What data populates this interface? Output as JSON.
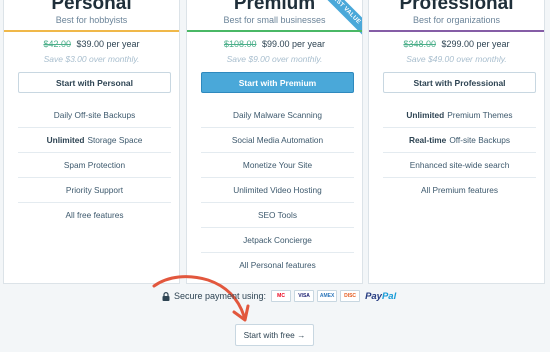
{
  "plans": {
    "personal": {
      "name": "Personal",
      "subtitle": "Best for hobbyists",
      "old_price": "$42.00",
      "price": "$39.00 per year",
      "savings": "Save $3.00 over monthly.",
      "button": "Start with Personal",
      "features": [
        {
          "bold": "",
          "text": "Daily Off-site Backups"
        },
        {
          "bold": "Unlimited",
          "text": "Storage Space"
        },
        {
          "bold": "",
          "text": "Spam Protection"
        },
        {
          "bold": "",
          "text": "Priority Support"
        },
        {
          "bold": "",
          "text": "All free features"
        }
      ]
    },
    "premium": {
      "name": "Premium",
      "subtitle": "Best for small businesses",
      "ribbon": "BEST VALUE",
      "old_price": "$108.00",
      "price": "$99.00 per year",
      "savings": "Save $9.00 over monthly.",
      "button": "Start with Premium",
      "features": [
        {
          "bold": "",
          "text": "Daily Malware Scanning"
        },
        {
          "bold": "",
          "text": "Social Media Automation"
        },
        {
          "bold": "",
          "text": "Monetize Your Site"
        },
        {
          "bold": "",
          "text": "Unlimited Video Hosting"
        },
        {
          "bold": "",
          "text": "SEO Tools"
        },
        {
          "bold": "",
          "text": "Jetpack Concierge"
        },
        {
          "bold": "",
          "text": "All Personal features"
        }
      ]
    },
    "professional": {
      "name": "Professional",
      "subtitle": "Best for organizations",
      "old_price": "$348.00",
      "price": "$299.00 per year",
      "savings": "Save $49.00 over monthly.",
      "button": "Start with Professional",
      "features": [
        {
          "bold": "Unlimited",
          "text": "Premium Themes"
        },
        {
          "bold": "Real-time",
          "text": "Off-site Backups"
        },
        {
          "bold": "",
          "text": "Enhanced site-wide search"
        },
        {
          "bold": "",
          "text": "All Premium features"
        }
      ]
    }
  },
  "secure_payment": {
    "label": "Secure payment using:",
    "cards": [
      {
        "name": "mastercard-icon",
        "text": "MC",
        "color": "#eb001b"
      },
      {
        "name": "visa-icon",
        "text": "VISA",
        "color": "#1a1f71"
      },
      {
        "name": "amex-icon",
        "text": "AMEX",
        "color": "#2e77bb"
      },
      {
        "name": "discover-icon",
        "text": "DISC",
        "color": "#e55c20"
      }
    ],
    "paypal_a": "Pay",
    "paypal_b": "Pal"
  },
  "free_button": "Start with free →",
  "colors": {
    "personal_accent": "#f0b849",
    "premium_accent": "#4ab866",
    "professional_accent": "#855da6",
    "arrow": "#e2573d"
  }
}
